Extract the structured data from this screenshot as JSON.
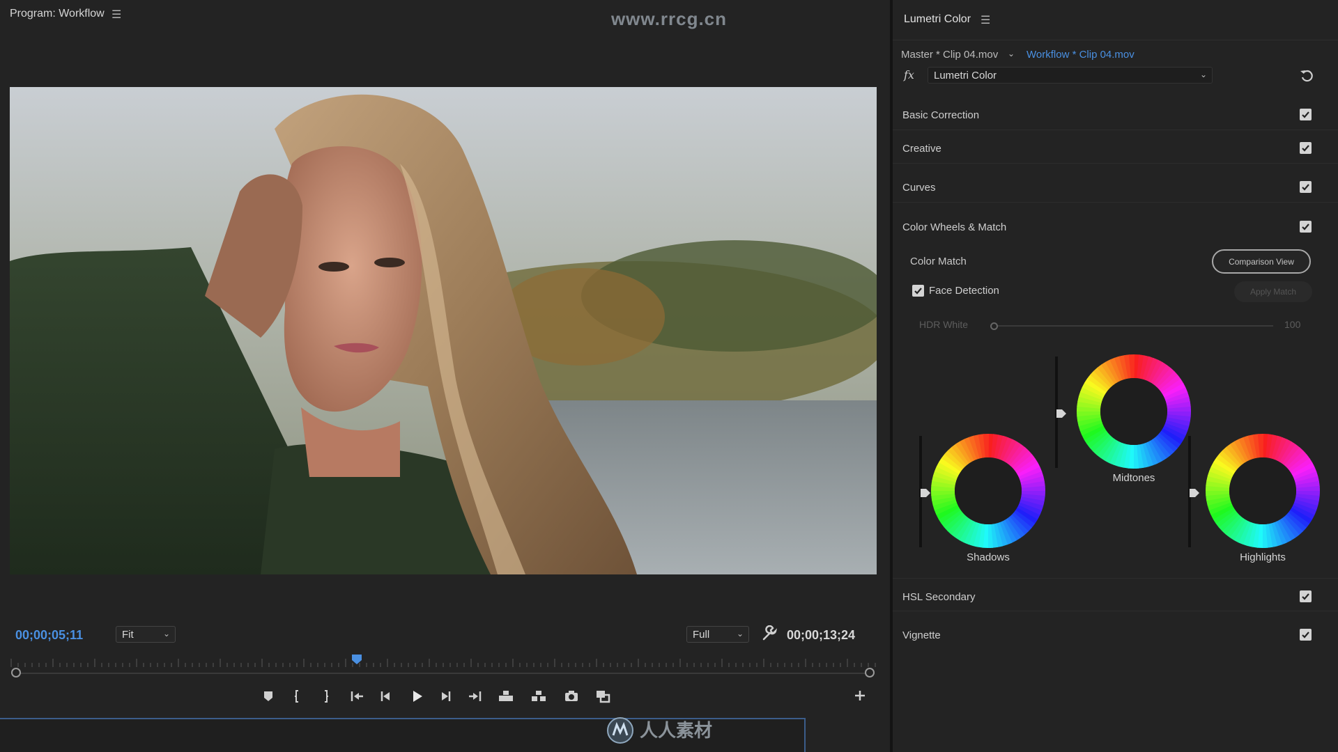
{
  "watermark": "www.rrcg.cn",
  "footer_logo_text": "人人素材",
  "program": {
    "title": "Program: Workflow",
    "timecode_current": "00;00;05;11",
    "timecode_duration": "00;00;13;24",
    "zoom_select": "Fit",
    "resolution_select": "Full",
    "playhead_fraction": 0.4,
    "transport_icons": [
      "marker-icon",
      "mark-in-icon",
      "mark-out-icon",
      "go-to-in-icon",
      "step-back-icon",
      "play-icon",
      "step-forward-icon",
      "go-to-out-icon",
      "lift-icon",
      "extract-icon",
      "camera-icon",
      "comparison-view-icon"
    ]
  },
  "lumetri": {
    "title": "Lumetri Color",
    "master_clip": "Master * Clip 04.mov",
    "sequence_clip": "Workflow * Clip 04.mov",
    "fx_label": "fx",
    "effect": "Lumetri Color",
    "sections": {
      "basic": "Basic Correction",
      "creative": "Creative",
      "curves": "Curves",
      "wheels": "Color Wheels & Match",
      "hsl": "HSL Secondary",
      "vignette": "Vignette"
    },
    "color_match": {
      "label": "Color Match",
      "comparison_button": "Comparison View",
      "face_detection": "Face Detection",
      "apply_button": "Apply Match",
      "hdr_label": "HDR White",
      "hdr_value": "100"
    },
    "wheels": {
      "shadows": "Shadows",
      "midtones": "Midtones",
      "highlights": "Highlights"
    }
  },
  "colors": {
    "accent": "#4a90e2",
    "panel_bg": "#232323",
    "border": "#3b5d8a"
  }
}
